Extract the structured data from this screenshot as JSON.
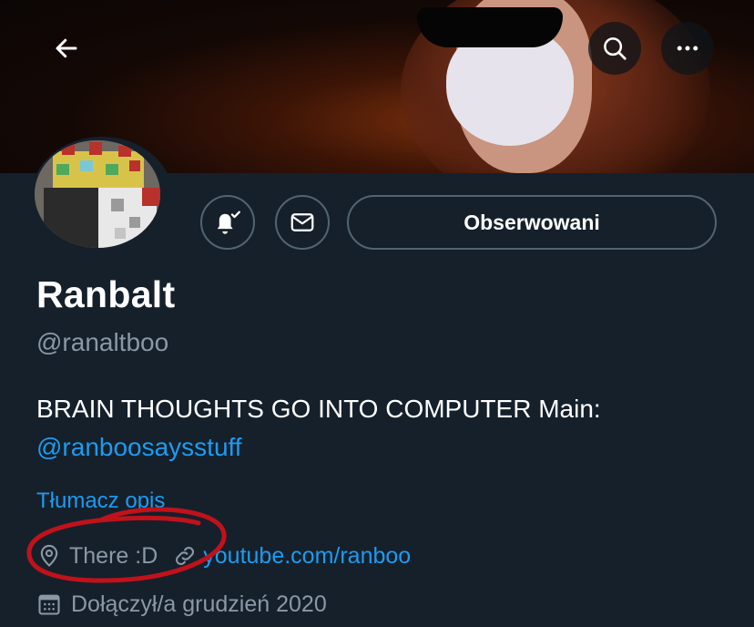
{
  "profile": {
    "display_name": "Ranbalt",
    "handle": "@ranaltboo",
    "bio_text": "BRAIN THOUGHTS GO INTO COMPUTER Main:",
    "bio_mention": "@ranboosaysstuff",
    "translate_label": "Tłumacz opis",
    "location": "There :D",
    "website": "youtube.com/ranboo",
    "joined": "Dołączył/a grudzień 2020"
  },
  "actions": {
    "follow_label": "Obserwowani"
  },
  "icons": {
    "back": "arrow-left-icon",
    "search": "search-icon",
    "more": "more-horizontal-icon",
    "notify": "bell-check-icon",
    "message": "envelope-icon",
    "location": "location-pin-icon",
    "link": "link-icon",
    "calendar": "calendar-icon"
  },
  "colors": {
    "background": "#15202b",
    "accent": "#1d9bf0",
    "secondary_text": "#8b98a5",
    "border": "#536471",
    "annotation": "#c0121b"
  }
}
